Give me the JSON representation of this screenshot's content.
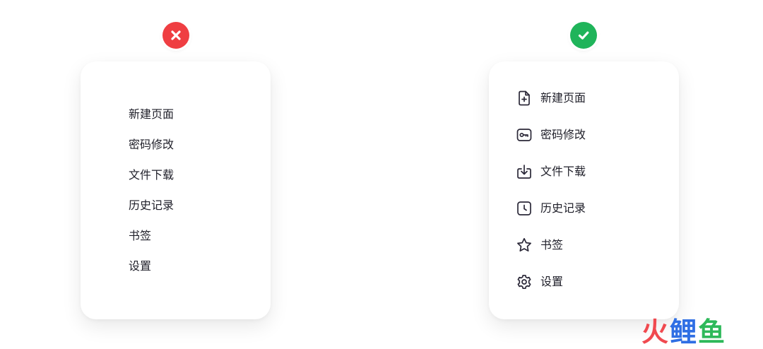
{
  "colors": {
    "bad": "#ef3e42",
    "good": "#1fb45a",
    "text": "#1f1f29",
    "icon_stroke": "#2b2838",
    "watermark_red": "#f0494f",
    "watermark_blue": "#2f6fe4",
    "watermark_green": "#2eb95a"
  },
  "bad_example": {
    "badge_icon": "x-mark-icon",
    "items": [
      "新建页面",
      "密码修改",
      "文件下载",
      "历史记录",
      "书签",
      "设置"
    ]
  },
  "good_example": {
    "badge_icon": "check-mark-icon",
    "items": [
      {
        "label": "新建页面",
        "icon": "new-page-icon"
      },
      {
        "label": "密码修改",
        "icon": "key-icon"
      },
      {
        "label": "文件下载",
        "icon": "download-icon"
      },
      {
        "label": "历史记录",
        "icon": "clock-icon"
      },
      {
        "label": "书签",
        "icon": "star-icon"
      },
      {
        "label": "设置",
        "icon": "gear-icon"
      }
    ]
  },
  "watermark": {
    "chars": [
      "火",
      "鲤",
      "鱼"
    ]
  }
}
